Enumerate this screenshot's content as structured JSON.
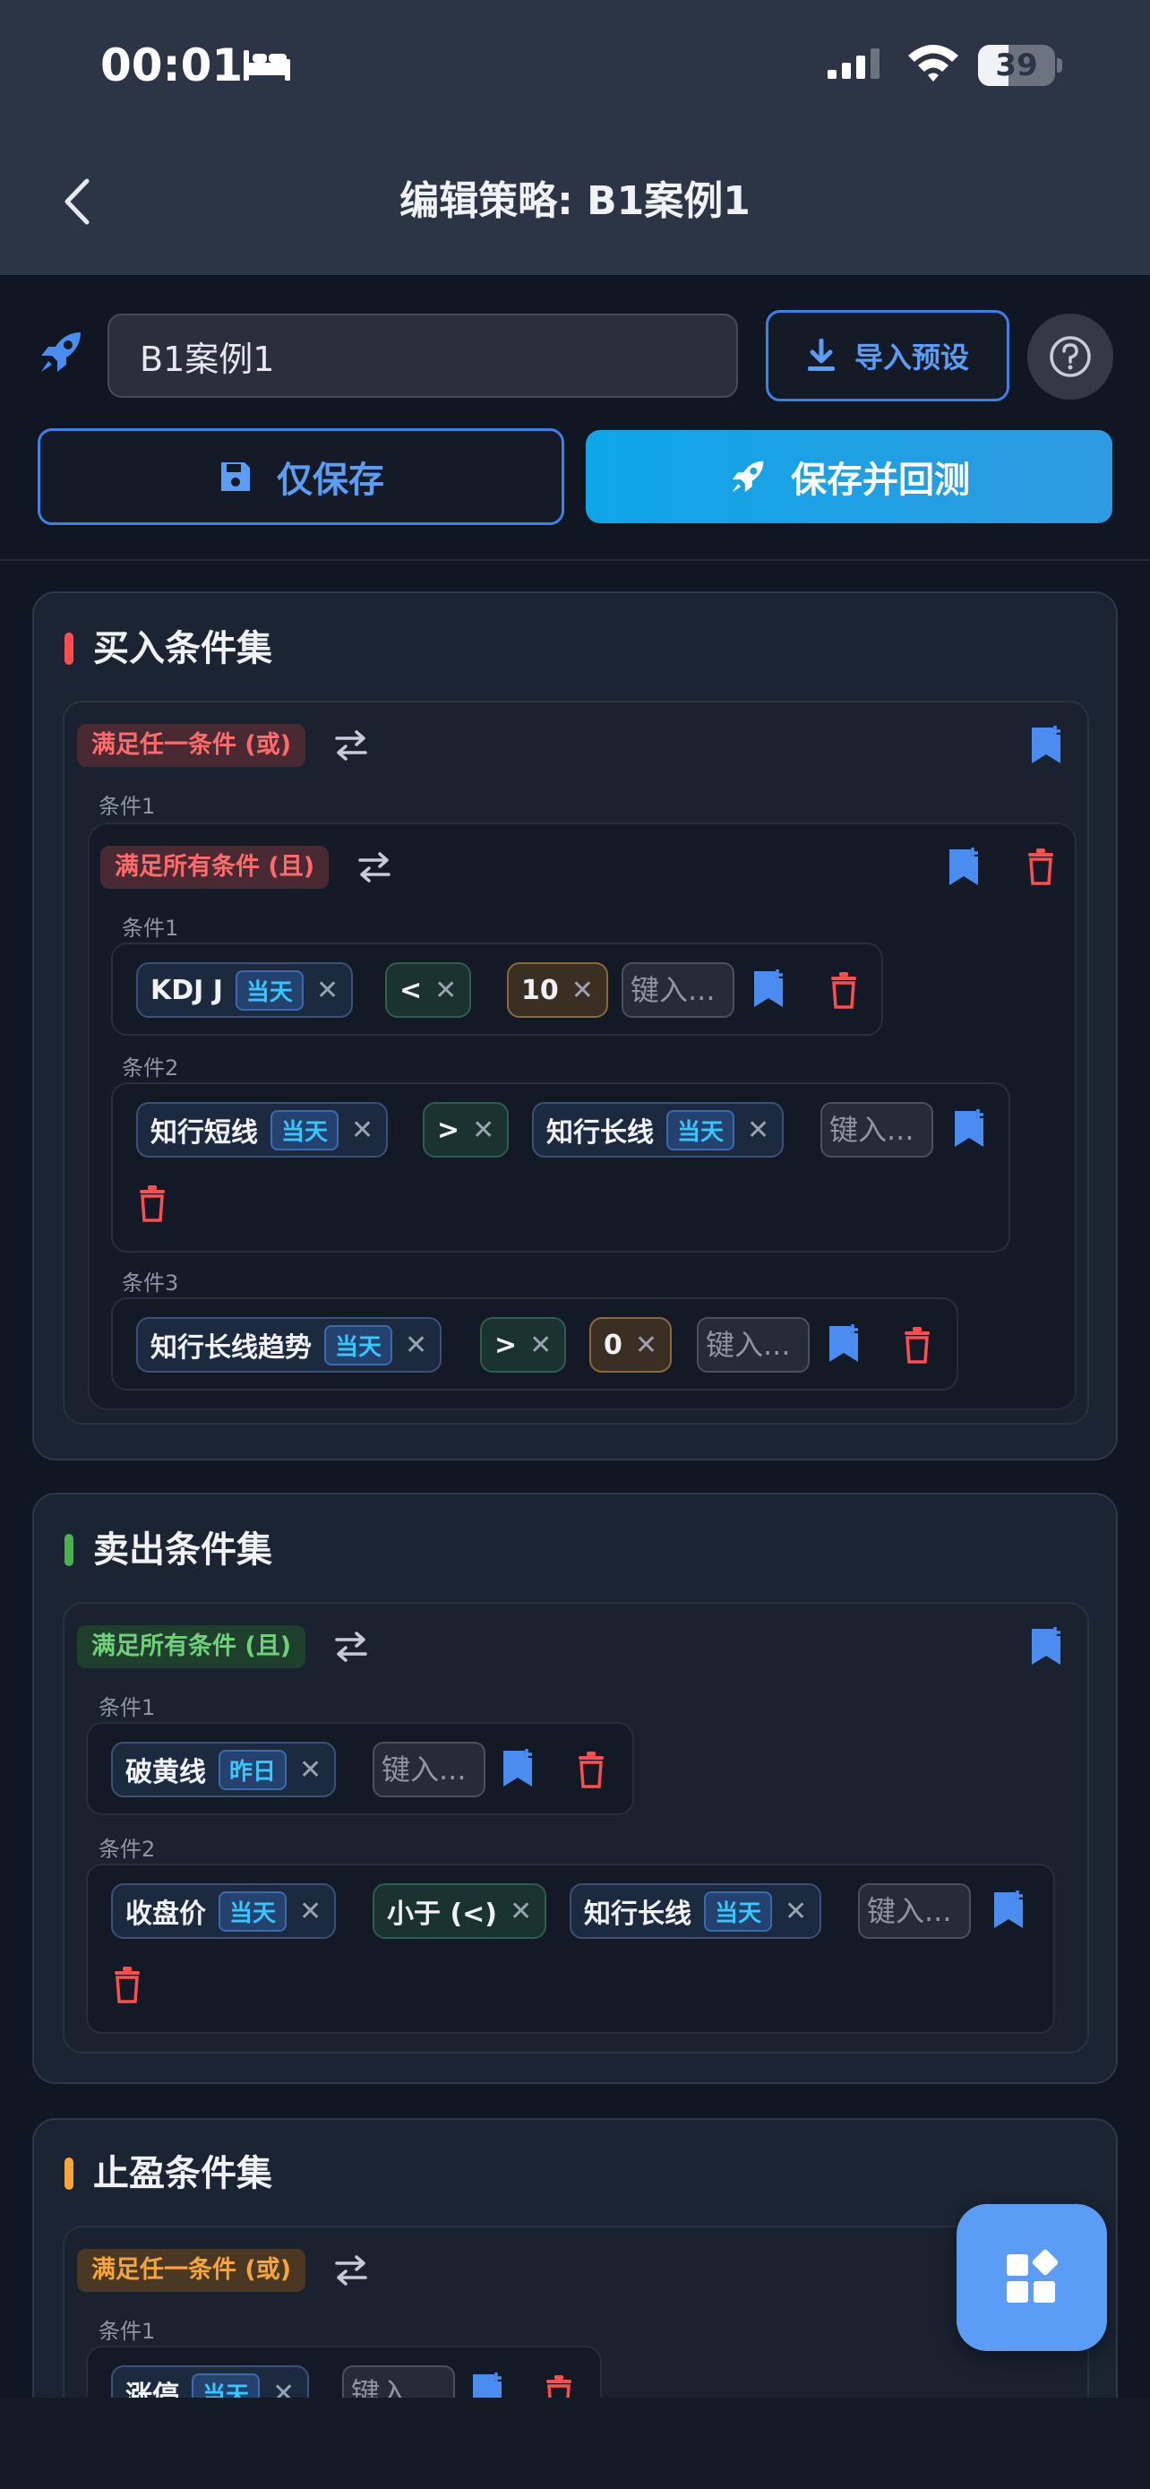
{
  "status": {
    "time": "00:01",
    "battery": "39",
    "battery_level": 0.39
  },
  "nav": {
    "title": "编辑策略: B1案例1"
  },
  "form": {
    "name_value": "B1案例1",
    "import_label": "导入预设",
    "save_only_label": "仅保存",
    "save_test_label": "保存并回测"
  },
  "colors": {
    "accent": "#3e80e8",
    "buy": "#ff4d4f",
    "sell": "#4caf50",
    "take_profit": "#f5a53a"
  },
  "buy": {
    "title": "买入条件集",
    "logic": "满足任一条件 (或)",
    "cond1_label": "条件1",
    "inner_logic": "满足所有条件 (且)",
    "rows": [
      {
        "label": "条件1",
        "left": "KDJ J",
        "left_tag": "当天",
        "op": "<",
        "right": "10"
      },
      {
        "label": "条件2",
        "left": "知行短线",
        "left_tag": "当天",
        "op": ">",
        "right": "知行长线",
        "right_tag": "当天"
      },
      {
        "label": "条件3",
        "left": "知行长线趋势",
        "left_tag": "当天",
        "op": ">",
        "right": "0"
      }
    ]
  },
  "sell": {
    "title": "卖出条件集",
    "logic": "满足所有条件 (且)",
    "rows": [
      {
        "label": "条件1",
        "left": "破黄线",
        "left_tag": "昨日"
      },
      {
        "label": "条件2",
        "left": "收盘价",
        "left_tag": "当天",
        "op": "小于 (<)",
        "right": "知行长线",
        "right_tag": "当天"
      }
    ]
  },
  "tp": {
    "title": "止盈条件集",
    "logic": "满足任一条件 (或)",
    "rows": [
      {
        "label": "条件1",
        "left": "涨停",
        "left_tag": "当天"
      }
    ]
  },
  "placeholder": "键入..."
}
